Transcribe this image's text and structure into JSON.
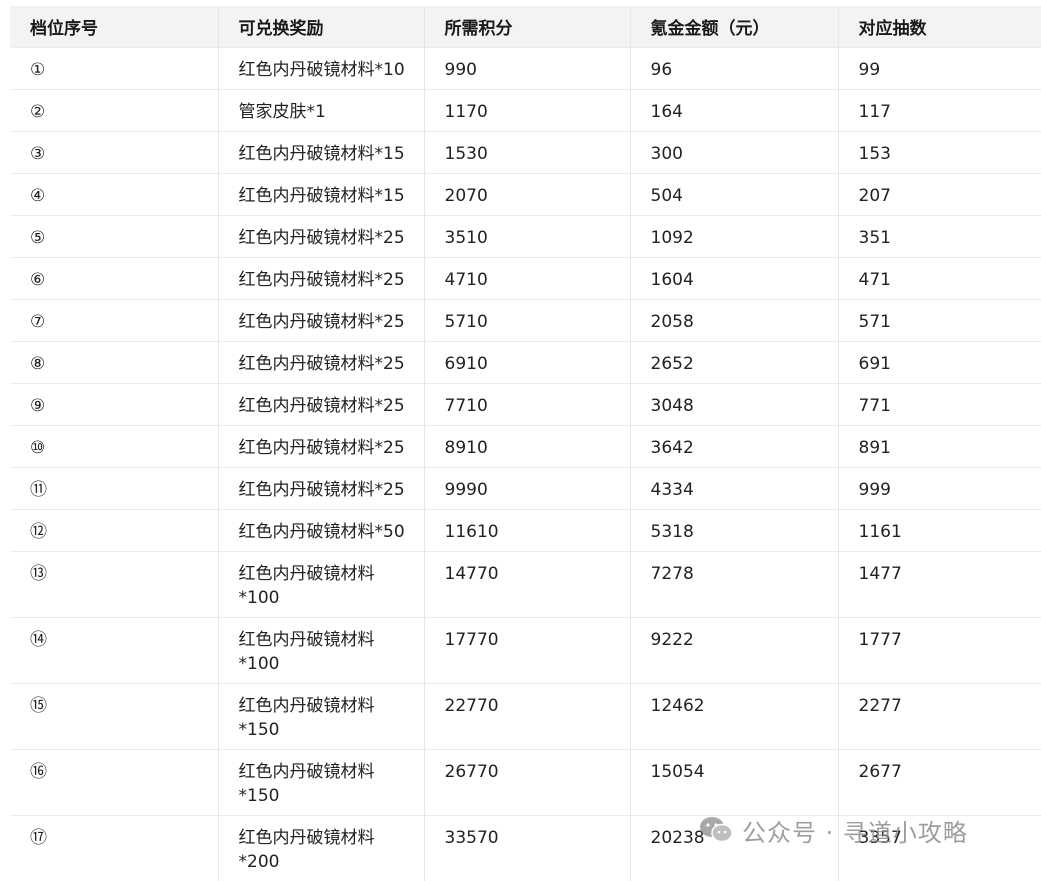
{
  "table": {
    "headers": [
      "档位序号",
      "可兑换奖励",
      "所需积分",
      "氪金金额（元）",
      "对应抽数"
    ],
    "rows": [
      [
        "①",
        "红色内丹破镜材料*10",
        "990",
        "96",
        "99"
      ],
      [
        "②",
        "管家皮肤*1",
        "1170",
        "164",
        "117"
      ],
      [
        "③",
        "红色内丹破镜材料*15",
        "1530",
        "300",
        "153"
      ],
      [
        "④",
        "红色内丹破镜材料*15",
        "2070",
        "504",
        "207"
      ],
      [
        "⑤",
        "红色内丹破镜材料*25",
        "3510",
        "1092",
        "351"
      ],
      [
        "⑥",
        "红色内丹破镜材料*25",
        "4710",
        "1604",
        "471"
      ],
      [
        "⑦",
        "红色内丹破镜材料*25",
        "5710",
        "2058",
        "571"
      ],
      [
        "⑧",
        "红色内丹破镜材料*25",
        "6910",
        "2652",
        "691"
      ],
      [
        "⑨",
        "红色内丹破镜材料*25",
        "7710",
        "3048",
        "771"
      ],
      [
        "⑩",
        "红色内丹破镜材料*25",
        "8910",
        "3642",
        "891"
      ],
      [
        "⑪",
        "红色内丹破镜材料*25",
        "9990",
        "4334",
        "999"
      ],
      [
        "⑫",
        "红色内丹破镜材料*50",
        "11610",
        "5318",
        "1161"
      ],
      [
        "⑬",
        "红色内丹破镜材料*100",
        "14770",
        "7278",
        "1477"
      ],
      [
        "⑭",
        "红色内丹破镜材料*100",
        "17770",
        "9222",
        "1777"
      ],
      [
        "⑮",
        "红色内丹破镜材料*150",
        "22770",
        "12462",
        "2277"
      ],
      [
        "⑯",
        "红色内丹破镜材料*150",
        "26770",
        "15054",
        "2677"
      ],
      [
        "⑰",
        "红色内丹破镜材料*200",
        "33570",
        "20238",
        "3357"
      ]
    ],
    "wrapped_rows": [
      12,
      13,
      14,
      15,
      16
    ]
  },
  "watermark": {
    "icon": "wechat-icon",
    "text": "公众号 · 寻道小攻略"
  },
  "colors": {
    "header_bg": "#f3f3f5",
    "border": "#e6e6e6",
    "watermark": "#8e8e8e"
  }
}
